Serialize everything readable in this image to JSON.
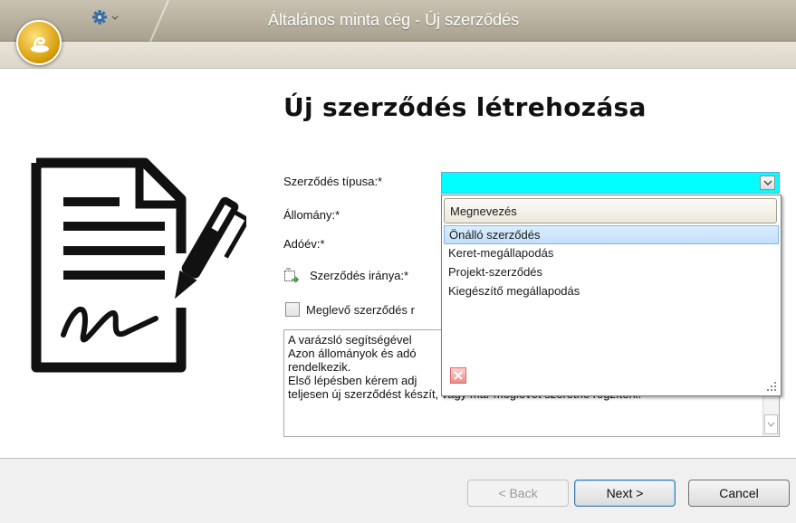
{
  "window": {
    "title": "Általános minta cég - Új szerződés"
  },
  "page": {
    "heading": "Új szerződés létrehozása"
  },
  "form": {
    "type_label": "Szerződés típusa:*",
    "type_value": "",
    "stock_label": "Állomány:*",
    "year_label": "Adóév:*",
    "direction_label": "Szerződés iránya:*",
    "existing_checkbox_label": "Meglevő szerződés r",
    "existing_checked": false
  },
  "description": {
    "lines": [
      "A varázsló segítségével",
      "Azon állományok és adó",
      "rendelkezik.",
      "Első lépésben kérem adj",
      "teljesen új szerződést készít, vagy már meglevőt szeretne rögzíteni."
    ]
  },
  "dropdown": {
    "header": "Megnevezés",
    "items": [
      "Önálló szerződés",
      "Keret-megállapodás",
      "Projekt-szerződés",
      "Kiegészítő megállapodás"
    ],
    "selected_index": 0
  },
  "footer": {
    "back_label": "< Back",
    "next_label": "Next >",
    "cancel_label": "Cancel",
    "back_enabled": false
  },
  "icons": {
    "app": "app-orb-icon",
    "settings": "gear-icon",
    "direction": "direction-swap-icon",
    "document": "contract-signature-icon",
    "close": "close-icon",
    "dropdown": "chevron-down-icon"
  },
  "colors": {
    "combo_highlight": "#00ffff",
    "selected_item": "#c2dffa"
  }
}
